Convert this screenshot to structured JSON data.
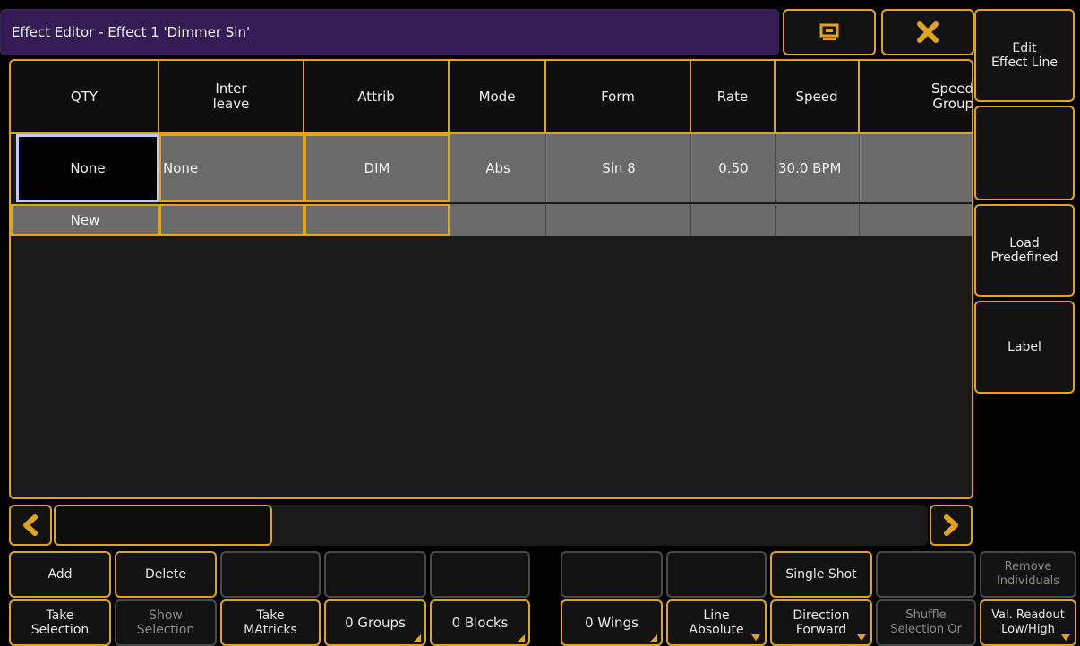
{
  "window": {
    "title": "Effect Editor - Effect 1 'Dimmer Sin'",
    "close_icon": "x-icon",
    "screen_icon": "monitor-icon"
  },
  "sidebar": {
    "items": [
      {
        "label": "Edit\nEffect Line"
      },
      {
        "label": ""
      },
      {
        "label": "Load\nPredefined"
      },
      {
        "label": "Label"
      }
    ]
  },
  "table": {
    "columns": [
      "QTY",
      "Inter\nleave",
      "Attrib",
      "Mode",
      "Form",
      "Rate",
      "Speed",
      "Speed\nGroup"
    ],
    "row1": [
      "None",
      "None",
      "DIM",
      "Abs",
      "Sin 8",
      "0.50",
      "30.0 BPM",
      ""
    ],
    "row2": [
      "New",
      "",
      "",
      "",
      "",
      "",
      "",
      ""
    ]
  },
  "scroll": {
    "left_icon": "chevron-left-icon",
    "right_icon": "chevron-right-icon"
  },
  "bottom_row1": [
    {
      "label": "Add",
      "enabled": true
    },
    {
      "label": "Delete",
      "enabled": true
    },
    {
      "label": "",
      "enabled": false
    },
    {
      "label": "",
      "enabled": false
    },
    {
      "label": "",
      "enabled": false
    },
    {
      "label": "",
      "enabled": false
    },
    {
      "label": "",
      "enabled": false
    },
    {
      "label": "Single Shot",
      "enabled": true
    },
    {
      "label": "",
      "enabled": false
    },
    {
      "label": "Remove\nIndividuals",
      "enabled": false
    }
  ],
  "bottom_row2": [
    {
      "label": "Take\nSelection",
      "enabled": true
    },
    {
      "label": "Show\nSelection",
      "enabled": false
    },
    {
      "label": "Take\nMAtricks",
      "enabled": true
    },
    {
      "label": "0 Groups",
      "enabled": true
    },
    {
      "label": "0 Blocks",
      "enabled": true
    },
    {
      "label": "0 Wings",
      "enabled": true
    },
    {
      "label": "Line\nAbsolute",
      "enabled": true
    },
    {
      "label": "Direction\nForward",
      "enabled": true
    },
    {
      "label": "Shuffle\nSelection Or",
      "enabled": false
    },
    {
      "label": "Val. Readout\nLow/High",
      "enabled": true
    }
  ],
  "colors": {
    "accent": "#e0a418",
    "title_bg": "#341c54",
    "cell_bg": "#6b6b6b"
  }
}
